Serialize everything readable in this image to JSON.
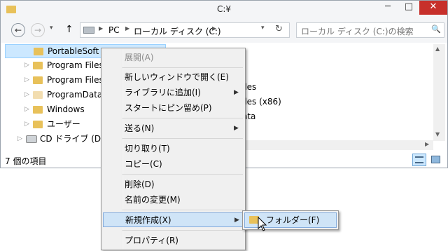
{
  "window": {
    "title": "C:¥",
    "minimize": "─",
    "maximize": "□",
    "close": "✕"
  },
  "nav": {
    "back": "←",
    "forward": "→",
    "up": "↑",
    "breadcrumb": [
      "PC",
      "ローカル ディスク (C:)"
    ],
    "refresh": "↻",
    "search_placeholder": "ローカル ディスク (C:)の検索",
    "search_icon": "🔍"
  },
  "tree": [
    {
      "label": "PortableSoft",
      "selected": true
    },
    {
      "label": "Program Files"
    },
    {
      "label": "Program Files"
    },
    {
      "label": "ProgramData"
    },
    {
      "label": "Windows"
    },
    {
      "label": "ユーザー"
    },
    {
      "label": "CD ドライブ (D:)"
    }
  ],
  "content_items": [
    "iles",
    "iles (x86)",
    "ata"
  ],
  "status": {
    "count": "7 個の項目"
  },
  "context_menu": {
    "items": [
      {
        "label": "展開(A)",
        "disabled": true
      },
      {
        "label": "新しいウィンドウで開く(E)"
      },
      {
        "label": "ライブラリに追加(I)",
        "submenu": true
      },
      {
        "label": "スタートにピン留め(P)"
      },
      {
        "label": "送る(N)",
        "submenu": true
      },
      {
        "label": "切り取り(T)"
      },
      {
        "label": "コピー(C)"
      },
      {
        "label": "削除(D)"
      },
      {
        "label": "名前の変更(M)"
      },
      {
        "label": "新規作成(X)",
        "submenu": true,
        "highlighted": true
      },
      {
        "label": "プロパティ(R)"
      }
    ],
    "submenu_arrow": "▶"
  },
  "submenu": {
    "items": [
      {
        "label": "フォルダー(F)"
      }
    ]
  }
}
